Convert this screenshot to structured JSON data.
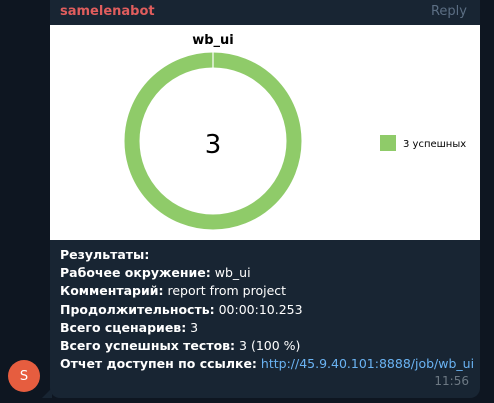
{
  "avatar": {
    "letter": "S",
    "color": "#e65d3f"
  },
  "message": {
    "sender": "samelenabot",
    "reply_label": "Reply",
    "time": "11:56",
    "lines": [
      {
        "label": "Результаты:",
        "value": ""
      },
      {
        "label": "Рабочее окружение:",
        "value": " wb_ui"
      },
      {
        "label": "Комментарий:",
        "value": " report from project"
      },
      {
        "label": "Продолжительность:",
        "value": " 00:00:10.253"
      },
      {
        "label": "Всего сценариев:",
        "value": " 3"
      },
      {
        "label": "Всего успешных тестов:",
        "value": " 3 (100 %)"
      },
      {
        "label": "Отчет доступен по ссылке:",
        "value": " ",
        "link": "http://45.9.40.101:8888/job/wb_ui"
      }
    ]
  },
  "chart_data": {
    "type": "pie",
    "title": "wb_ui",
    "center_label": "3",
    "slices": [
      {
        "label": "3 успешных",
        "value": 3,
        "color": "#8fcb69"
      }
    ]
  }
}
